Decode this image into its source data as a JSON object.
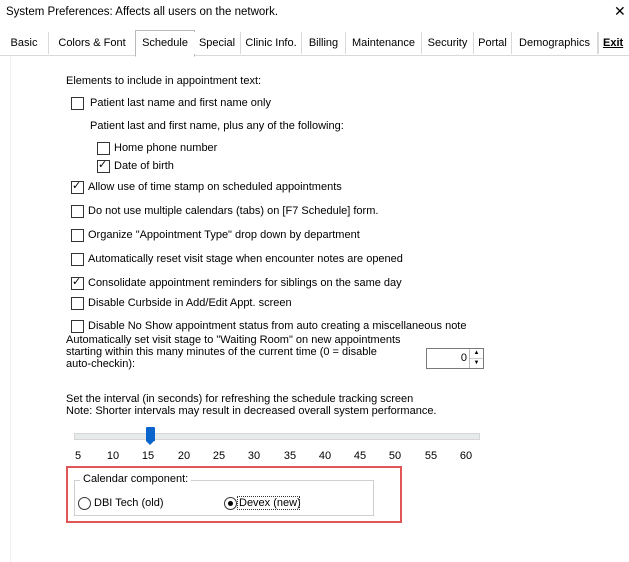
{
  "window": {
    "title": "System Preferences: Affects all users on the network.",
    "close_label": "✕"
  },
  "tabs": [
    {
      "label": "Basic"
    },
    {
      "label": "Colors & Font"
    },
    {
      "label": "Schedule"
    },
    {
      "label": "Special"
    },
    {
      "label": "Clinic Info."
    },
    {
      "label": "Billing"
    },
    {
      "label": "Maintenance"
    },
    {
      "label": "Security"
    },
    {
      "label": "Portal"
    },
    {
      "label": "Demographics"
    }
  ],
  "active_tab": "Schedule",
  "exit_label": "Exit",
  "schedule": {
    "elements_heading": "Elements to include in appointment text:",
    "opt_last_first_only": {
      "label": "Patient last name and first name only",
      "checked": false
    },
    "plus_heading": "Patient last and first name, plus any of the following:",
    "opt_home_phone": {
      "label": "Home phone number",
      "checked": false
    },
    "opt_dob": {
      "label": "Date of birth",
      "checked": true
    },
    "opt_time_stamp": {
      "label": "Allow use of time stamp on scheduled appointments",
      "checked": true
    },
    "opt_multi_calendars": {
      "label": "Do not use multiple calendars (tabs) on [F7 Schedule] form.",
      "checked": false
    },
    "opt_organize_appt_type": {
      "label": "Organize \"Appointment Type\" drop down by department",
      "checked": false
    },
    "opt_reset_visit_stage": {
      "label": "Automatically reset visit stage when encounter notes are opened",
      "checked": false
    },
    "opt_consolidate_reminders": {
      "label": "Consolidate appointment reminders for siblings on the same day",
      "checked": true
    },
    "opt_disable_curbside": {
      "label": "Disable Curbside in Add/Edit Appt. screen",
      "checked": false
    },
    "opt_disable_no_show": {
      "label": "Disable No Show appointment status from auto creating a miscellaneous note",
      "checked": false
    },
    "auto_checkin_text_1": "Automatically set visit stage to \"Waiting Room\" on new appointments",
    "auto_checkin_text_2": "starting within this many minutes of the current time (0 = disable",
    "auto_checkin_text_3": "auto-checkin):",
    "auto_checkin_value": "0",
    "refresh_text_1": "Set the interval (in seconds) for refreshing the schedule tracking screen",
    "refresh_text_2": "Note: Shorter intervals may result in decreased overall system performance.",
    "refresh_slider": {
      "ticks": [
        "5",
        "10",
        "15",
        "20",
        "25",
        "30",
        "35",
        "40",
        "45",
        "50",
        "55",
        "60"
      ],
      "value": 15
    },
    "calendar_component": {
      "title": "Calendar component:",
      "options": [
        {
          "label": "DBI Tech (old)",
          "selected": false
        },
        {
          "label": "Devex (new)",
          "selected": true
        }
      ]
    }
  },
  "colors": {
    "accent": "#0a64cc",
    "highlight_border": "#e05555"
  }
}
